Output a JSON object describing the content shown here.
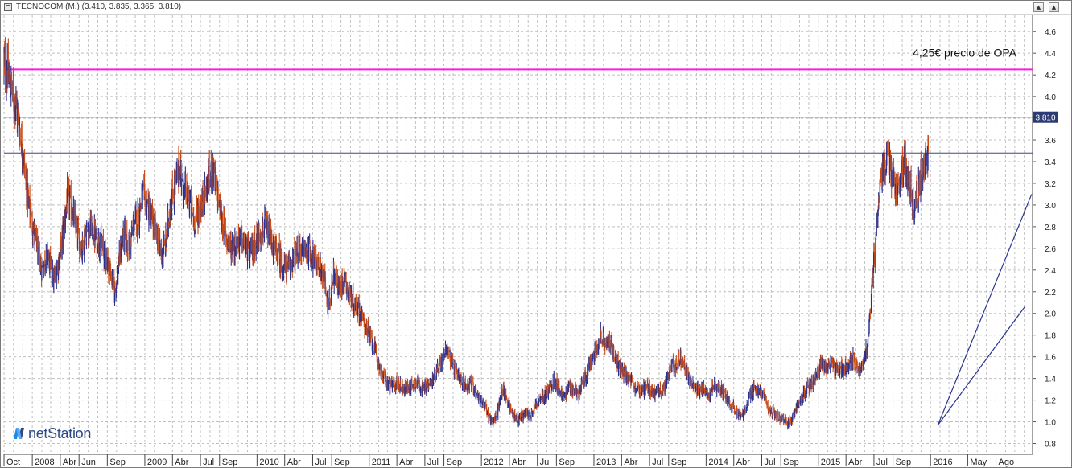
{
  "window": {
    "title": "TECNOCOM (M.) (3.410, 3.835, 3.365, 3.810)"
  },
  "logo": {
    "text": "netStation"
  },
  "colors": {
    "up": "#2b2f8c",
    "down": "#c84b18",
    "grid": "#bfbfbf",
    "opa_line": "#ff1ae8",
    "resistance_line": "#3b4c7a",
    "trendline": "#2a3590",
    "price_badge": "#2b3a73"
  },
  "chart_data": {
    "type": "ohlc",
    "title": "TECNOCOM (M.)",
    "last_bar": {
      "open": 3.41,
      "high": 3.835,
      "low": 3.365,
      "close": 3.81
    },
    "ylim": [
      0.7,
      4.75
    ],
    "y_ticks": [
      0.8,
      1.0,
      1.2,
      1.4,
      1.6,
      1.8,
      2.0,
      2.2,
      2.4,
      2.6,
      2.8,
      3.0,
      3.2,
      3.4,
      3.6,
      3.8,
      4.0,
      4.2,
      4.4,
      4.6
    ],
    "x_range": [
      "2007-10",
      "2016-11"
    ],
    "x_labels": [
      {
        "text": "Oct",
        "date": "2007-10"
      },
      {
        "text": "2008",
        "date": "2008-01"
      },
      {
        "text": "Abr",
        "date": "2008-04"
      },
      {
        "text": "Jun",
        "date": "2008-06"
      },
      {
        "text": "Sep",
        "date": "2008-09"
      },
      {
        "text": "2009",
        "date": "2009-01"
      },
      {
        "text": "Abr",
        "date": "2009-04"
      },
      {
        "text": "Jul",
        "date": "2009-07"
      },
      {
        "text": "Sep",
        "date": "2009-09"
      },
      {
        "text": "2010",
        "date": "2010-01"
      },
      {
        "text": "Abr",
        "date": "2010-04"
      },
      {
        "text": "Jul",
        "date": "2010-07"
      },
      {
        "text": "Sep",
        "date": "2010-09"
      },
      {
        "text": "2011",
        "date": "2011-01"
      },
      {
        "text": "Abr",
        "date": "2011-04"
      },
      {
        "text": "Jul",
        "date": "2011-07"
      },
      {
        "text": "Sep",
        "date": "2011-09"
      },
      {
        "text": "2012",
        "date": "2012-01"
      },
      {
        "text": "Abr",
        "date": "2012-04"
      },
      {
        "text": "Jul",
        "date": "2012-07"
      },
      {
        "text": "Sep",
        "date": "2012-09"
      },
      {
        "text": "2013",
        "date": "2013-01"
      },
      {
        "text": "Abr",
        "date": "2013-04"
      },
      {
        "text": "Jul",
        "date": "2013-07"
      },
      {
        "text": "Sep",
        "date": "2013-09"
      },
      {
        "text": "2014",
        "date": "2014-01"
      },
      {
        "text": "Abr",
        "date": "2014-04"
      },
      {
        "text": "Jul",
        "date": "2014-07"
      },
      {
        "text": "Sep",
        "date": "2014-09"
      },
      {
        "text": "2015",
        "date": "2015-01"
      },
      {
        "text": "Abr",
        "date": "2015-04"
      },
      {
        "text": "Jul",
        "date": "2015-07"
      },
      {
        "text": "Sep",
        "date": "2015-09"
      },
      {
        "text": "2016",
        "date": "2016-01"
      },
      {
        "text": "May",
        "date": "2016-05"
      },
      {
        "text": "Ago",
        "date": "2016-08"
      }
    ],
    "price_path": [
      [
        "2007-10-01",
        4.3
      ],
      [
        "2007-10-20",
        4.15
      ],
      [
        "2007-11-10",
        3.9
      ],
      [
        "2007-12-01",
        3.5
      ],
      [
        "2007-12-20",
        3.0
      ],
      [
        "2008-01-10",
        2.7
      ],
      [
        "2008-02-01",
        2.4
      ],
      [
        "2008-02-20",
        2.55
      ],
      [
        "2008-03-10",
        2.3
      ],
      [
        "2008-03-25",
        2.45
      ],
      [
        "2008-04-10",
        2.75
      ],
      [
        "2008-04-25",
        3.1
      ],
      [
        "2008-05-10",
        2.95
      ],
      [
        "2008-05-25",
        2.75
      ],
      [
        "2008-06-10",
        2.6
      ],
      [
        "2008-06-25",
        2.75
      ],
      [
        "2008-07-10",
        2.8
      ],
      [
        "2008-07-25",
        2.7
      ],
      [
        "2008-08-10",
        2.65
      ],
      [
        "2008-08-25",
        2.55
      ],
      [
        "2008-09-10",
        2.4
      ],
      [
        "2008-09-25",
        2.2
      ],
      [
        "2008-10-10",
        2.5
      ],
      [
        "2008-10-25",
        2.75
      ],
      [
        "2008-11-10",
        2.6
      ],
      [
        "2008-11-25",
        2.8
      ],
      [
        "2008-12-10",
        2.9
      ],
      [
        "2008-12-25",
        3.1
      ],
      [
        "2009-01-10",
        3.0
      ],
      [
        "2009-01-25",
        2.85
      ],
      [
        "2009-02-10",
        2.7
      ],
      [
        "2009-02-25",
        2.55
      ],
      [
        "2009-03-10",
        2.65
      ],
      [
        "2009-03-25",
        3.0
      ],
      [
        "2009-04-10",
        3.2
      ],
      [
        "2009-04-25",
        3.35
      ],
      [
        "2009-05-10",
        3.15
      ],
      [
        "2009-05-25",
        3.05
      ],
      [
        "2009-06-10",
        2.85
      ],
      [
        "2009-06-25",
        2.95
      ],
      [
        "2009-07-10",
        3.05
      ],
      [
        "2009-07-25",
        3.2
      ],
      [
        "2009-08-10",
        3.35
      ],
      [
        "2009-08-25",
        3.1
      ],
      [
        "2009-09-10",
        2.85
      ],
      [
        "2009-09-25",
        2.7
      ],
      [
        "2009-10-10",
        2.6
      ],
      [
        "2009-10-25",
        2.65
      ],
      [
        "2009-11-10",
        2.7
      ],
      [
        "2009-11-25",
        2.6
      ],
      [
        "2009-12-10",
        2.55
      ],
      [
        "2009-12-25",
        2.65
      ],
      [
        "2010-01-10",
        2.75
      ],
      [
        "2010-01-25",
        2.8
      ],
      [
        "2010-02-10",
        2.72
      ],
      [
        "2010-02-25",
        2.6
      ],
      [
        "2010-03-10",
        2.55
      ],
      [
        "2010-03-25",
        2.45
      ],
      [
        "2010-04-10",
        2.4
      ],
      [
        "2010-04-25",
        2.5
      ],
      [
        "2010-05-10",
        2.55
      ],
      [
        "2010-05-25",
        2.6
      ],
      [
        "2010-06-10",
        2.58
      ],
      [
        "2010-06-25",
        2.55
      ],
      [
        "2010-07-10",
        2.5
      ],
      [
        "2010-07-25",
        2.4
      ],
      [
        "2010-08-10",
        2.3
      ],
      [
        "2010-08-20",
        2.0
      ],
      [
        "2010-08-30",
        2.25
      ],
      [
        "2010-09-10",
        2.4
      ],
      [
        "2010-09-25",
        2.2
      ],
      [
        "2010-10-10",
        2.35
      ],
      [
        "2010-10-25",
        2.2
      ],
      [
        "2010-11-10",
        2.1
      ],
      [
        "2010-11-25",
        2.05
      ],
      [
        "2010-12-10",
        1.95
      ],
      [
        "2010-12-25",
        1.85
      ],
      [
        "2011-01-10",
        1.75
      ],
      [
        "2011-01-25",
        1.6
      ],
      [
        "2011-02-10",
        1.45
      ],
      [
        "2011-02-25",
        1.38
      ],
      [
        "2011-03-10",
        1.33
      ],
      [
        "2011-03-25",
        1.35
      ],
      [
        "2011-04-10",
        1.35
      ],
      [
        "2011-04-25",
        1.3
      ],
      [
        "2011-05-10",
        1.32
      ],
      [
        "2011-05-25",
        1.35
      ],
      [
        "2011-06-10",
        1.36
      ],
      [
        "2011-06-25",
        1.3
      ],
      [
        "2011-07-10",
        1.32
      ],
      [
        "2011-07-25",
        1.38
      ],
      [
        "2011-08-10",
        1.5
      ],
      [
        "2011-08-25",
        1.55
      ],
      [
        "2011-09-10",
        1.7
      ],
      [
        "2011-09-25",
        1.55
      ],
      [
        "2011-10-10",
        1.45
      ],
      [
        "2011-10-25",
        1.38
      ],
      [
        "2011-11-10",
        1.33
      ],
      [
        "2011-11-25",
        1.36
      ],
      [
        "2011-12-10",
        1.3
      ],
      [
        "2011-12-25",
        1.22
      ],
      [
        "2012-01-10",
        1.15
      ],
      [
        "2012-01-25",
        1.05
      ],
      [
        "2012-02-10",
        1.0
      ],
      [
        "2012-02-25",
        1.12
      ],
      [
        "2012-03-10",
        1.3
      ],
      [
        "2012-03-25",
        1.2
      ],
      [
        "2012-04-10",
        1.08
      ],
      [
        "2012-04-25",
        1.03
      ],
      [
        "2012-05-10",
        1.05
      ],
      [
        "2012-05-25",
        1.08
      ],
      [
        "2012-06-10",
        1.05
      ],
      [
        "2012-06-25",
        1.15
      ],
      [
        "2012-07-10",
        1.2
      ],
      [
        "2012-07-25",
        1.25
      ],
      [
        "2012-08-10",
        1.3
      ],
      [
        "2012-08-25",
        1.4
      ],
      [
        "2012-09-10",
        1.3
      ],
      [
        "2012-09-25",
        1.22
      ],
      [
        "2012-10-10",
        1.32
      ],
      [
        "2012-10-25",
        1.3
      ],
      [
        "2012-11-10",
        1.25
      ],
      [
        "2012-11-25",
        1.35
      ],
      [
        "2012-12-10",
        1.45
      ],
      [
        "2012-12-25",
        1.6
      ],
      [
        "2013-01-10",
        1.7
      ],
      [
        "2013-01-25",
        1.8
      ],
      [
        "2013-02-10",
        1.7
      ],
      [
        "2013-02-25",
        1.75
      ],
      [
        "2013-03-10",
        1.6
      ],
      [
        "2013-03-25",
        1.5
      ],
      [
        "2013-04-10",
        1.45
      ],
      [
        "2013-04-25",
        1.4
      ],
      [
        "2013-05-10",
        1.32
      ],
      [
        "2013-05-25",
        1.28
      ],
      [
        "2013-06-10",
        1.3
      ],
      [
        "2013-06-25",
        1.35
      ],
      [
        "2013-07-10",
        1.25
      ],
      [
        "2013-07-25",
        1.28
      ],
      [
        "2013-08-10",
        1.3
      ],
      [
        "2013-08-25",
        1.35
      ],
      [
        "2013-09-10",
        1.55
      ],
      [
        "2013-09-25",
        1.5
      ],
      [
        "2013-10-10",
        1.6
      ],
      [
        "2013-10-25",
        1.48
      ],
      [
        "2013-11-10",
        1.38
      ],
      [
        "2013-11-25",
        1.3
      ],
      [
        "2013-12-10",
        1.28
      ],
      [
        "2013-12-25",
        1.32
      ],
      [
        "2014-01-10",
        1.25
      ],
      [
        "2014-01-25",
        1.35
      ],
      [
        "2014-02-10",
        1.3
      ],
      [
        "2014-02-25",
        1.28
      ],
      [
        "2014-03-10",
        1.22
      ],
      [
        "2014-03-25",
        1.15
      ],
      [
        "2014-04-10",
        1.1
      ],
      [
        "2014-04-25",
        1.05
      ],
      [
        "2014-05-10",
        1.12
      ],
      [
        "2014-05-25",
        1.25
      ],
      [
        "2014-06-10",
        1.32
      ],
      [
        "2014-06-25",
        1.28
      ],
      [
        "2014-07-10",
        1.2
      ],
      [
        "2014-07-25",
        1.1
      ],
      [
        "2014-08-10",
        1.08
      ],
      [
        "2014-08-25",
        1.05
      ],
      [
        "2014-09-10",
        1.02
      ],
      [
        "2014-09-25",
        0.97
      ],
      [
        "2014-10-10",
        1.05
      ],
      [
        "2014-10-25",
        1.15
      ],
      [
        "2014-11-10",
        1.22
      ],
      [
        "2014-11-25",
        1.3
      ],
      [
        "2014-12-10",
        1.35
      ],
      [
        "2014-12-25",
        1.42
      ],
      [
        "2015-01-10",
        1.55
      ],
      [
        "2015-01-25",
        1.5
      ],
      [
        "2015-02-10",
        1.55
      ],
      [
        "2015-02-25",
        1.45
      ],
      [
        "2015-03-10",
        1.5
      ],
      [
        "2015-03-25",
        1.48
      ],
      [
        "2015-04-10",
        1.55
      ],
      [
        "2015-04-25",
        1.58
      ],
      [
        "2015-05-10",
        1.5
      ],
      [
        "2015-05-25",
        1.52
      ],
      [
        "2015-06-10",
        1.7
      ],
      [
        "2015-06-25",
        2.3
      ],
      [
        "2015-07-10",
        2.8
      ],
      [
        "2015-07-25",
        3.3
      ],
      [
        "2015-08-10",
        3.45
      ],
      [
        "2015-08-25",
        3.3
      ],
      [
        "2015-09-10",
        3.1
      ],
      [
        "2015-09-25",
        3.25
      ],
      [
        "2015-10-10",
        3.4
      ],
      [
        "2015-10-25",
        3.2
      ],
      [
        "2015-11-10",
        3.0
      ],
      [
        "2015-11-25",
        3.2
      ],
      [
        "2015-12-10",
        3.35
      ],
      [
        "2015-12-25",
        3.5
      ]
    ],
    "annotations": [
      {
        "type": "hline",
        "value": 4.25,
        "label": "4,25€ precio de OPA",
        "color": "opa"
      },
      {
        "type": "hline",
        "value": 3.81,
        "color": "resistance"
      },
      {
        "type": "hline",
        "value": 3.48,
        "color": "resistance"
      }
    ],
    "trendlines": [
      [
        [
          "2016-01-25",
          0.97
        ],
        [
          "2016-11-05",
          2.07
        ]
      ],
      [
        [
          "2016-01-25",
          0.97
        ],
        [
          "2016-11-25",
          3.1
        ]
      ]
    ],
    "last_price_label": "3.810"
  }
}
